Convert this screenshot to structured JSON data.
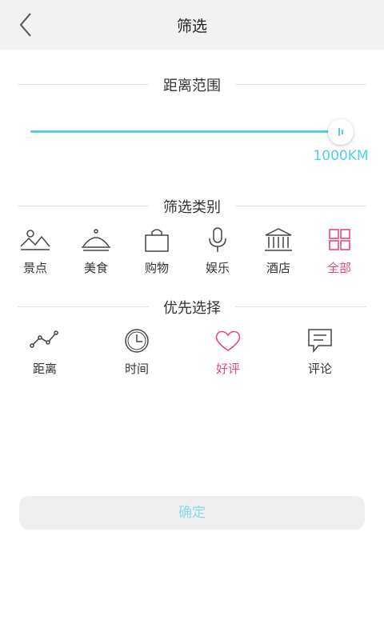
{
  "header": {
    "title": "筛选",
    "back_icon": "chevron-left-icon"
  },
  "distance": {
    "section_title": "距离范围",
    "value_label": "1000KM",
    "slider_fraction": 1.0,
    "accent_color": "#55cfe3"
  },
  "categories": {
    "section_title": "筛选类别",
    "items": [
      {
        "label": "景点",
        "icon": "landscape-icon",
        "selected": false
      },
      {
        "label": "美食",
        "icon": "food-cloche-icon",
        "selected": false
      },
      {
        "label": "购物",
        "icon": "shopping-bag-icon",
        "selected": false
      },
      {
        "label": "娱乐",
        "icon": "microphone-icon",
        "selected": false
      },
      {
        "label": "酒店",
        "icon": "hotel-building-icon",
        "selected": false
      },
      {
        "label": "全部",
        "icon": "grid-icon",
        "selected": true
      }
    ]
  },
  "priority": {
    "section_title": "优先选择",
    "items": [
      {
        "label": "距离",
        "icon": "route-line-icon",
        "selected": false
      },
      {
        "label": "时间",
        "icon": "clock-icon",
        "selected": false
      },
      {
        "label": "好评",
        "icon": "heart-icon",
        "selected": true
      },
      {
        "label": "评论",
        "icon": "comment-icon",
        "selected": false
      }
    ]
  },
  "confirm_label": "确定",
  "colors": {
    "selected": "#e44b7d",
    "accent": "#55cfe3"
  }
}
